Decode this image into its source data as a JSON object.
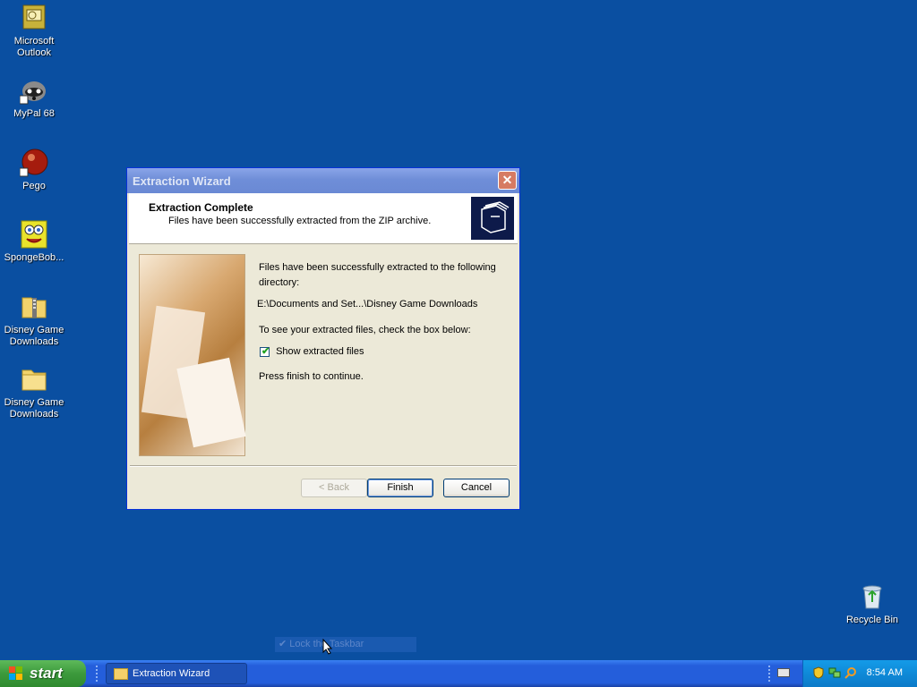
{
  "desktop": {
    "icons": [
      {
        "label": "Microsoft Outlook",
        "line1": "Microsoft",
        "line2": "Outlook"
      },
      {
        "label": "MyPal 68",
        "line1": "MyPal 68",
        "line2": ""
      },
      {
        "label": "Pego",
        "line1": "Pego",
        "line2": ""
      },
      {
        "label": "SpongeBob...",
        "line1": "SpongeBob...",
        "line2": ""
      },
      {
        "label": "Disney Game Downloads",
        "line1": "Disney Game",
        "line2": "Downloads"
      },
      {
        "label": "Disney Game Downloads",
        "line1": "Disney Game",
        "line2": "Downloads"
      }
    ],
    "recycle_bin": "Recycle Bin",
    "background_color": "#0a4fa1"
  },
  "dialog": {
    "title": "Extraction Wizard",
    "close_glyph": "✕",
    "header_title": "Extraction Complete",
    "header_subtitle": "Files have been successfully extracted from the ZIP archive.",
    "message_line1": "Files have been successfully extracted to the following",
    "message_line2": "directory:",
    "path": "E:\\Documents and Set...\\Disney Game Downloads",
    "instruction": "To see your extracted files, check the box below:",
    "checkbox_label": "Show extracted files",
    "checkbox_checked": true,
    "checkbox_mark": "✔",
    "continue_text": "Press finish to continue.",
    "buttons": {
      "back": "< Back",
      "finish": "Finish",
      "cancel": "Cancel"
    }
  },
  "ghost_menu": {
    "check": "✔",
    "text": "Lock the Taskbar"
  },
  "taskbar": {
    "start_label": "start",
    "task_label": "Extraction Wizard",
    "clock": "8:54 AM"
  }
}
